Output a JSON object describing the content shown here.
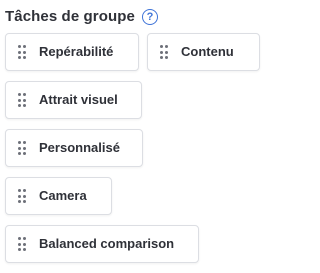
{
  "header": {
    "title": "Tâches de groupe",
    "help_glyph": "?",
    "help_icon": "question-circle-icon",
    "accent_color": "#3f74d8"
  },
  "tasks": [
    {
      "label": "Repérabilité",
      "icon": "drag-handle-icon"
    },
    {
      "label": "Contenu",
      "icon": "drag-handle-icon"
    },
    {
      "label": "Attrait visuel",
      "icon": "drag-handle-icon"
    },
    {
      "label": "Personnalisé",
      "icon": "drag-handle-icon"
    },
    {
      "label": "Camera",
      "icon": "drag-handle-icon"
    },
    {
      "label": "Balanced comparison",
      "icon": "drag-handle-icon"
    }
  ]
}
